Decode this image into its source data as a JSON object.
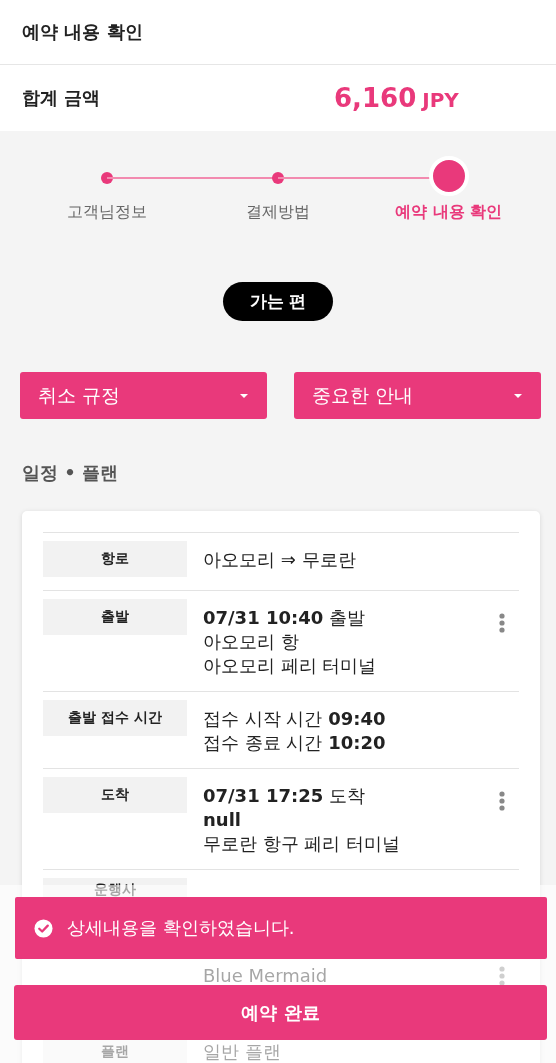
{
  "header": {
    "title": "예약 내용 확인"
  },
  "total": {
    "label": "합계 금액",
    "amount": "6,160",
    "currency": "JPY"
  },
  "steps": [
    {
      "label": "고객님정보",
      "selected": false
    },
    {
      "label": "결제방법",
      "selected": false
    },
    {
      "label": "예약 내용 확인",
      "selected": true
    }
  ],
  "direction_badge": "가는 편",
  "dropdowns": [
    {
      "label": "취소 규정"
    },
    {
      "label": "중요한 안내"
    }
  ],
  "section_title": "일정 • 플랜",
  "rows": [
    {
      "label": "항로",
      "lines": [
        "아오모리 ⇒ 무로란"
      ],
      "has_menu": false
    },
    {
      "label": "출발",
      "lines": [
        "**07/31 10:40** 출발",
        "아오모리 항",
        "아오모리 페리 터미널"
      ],
      "has_menu": true
    },
    {
      "label": "출발 접수 시간",
      "lines": [
        "접수 시작 시간 **09:40**",
        "접수 종료 시간 **10:20**"
      ],
      "has_menu": false
    },
    {
      "label": "도착",
      "lines": [
        "**07/31 17:25** 도착",
        "**null**",
        "무로란 항구 페리 터미널"
      ],
      "has_menu": true
    },
    {
      "label": "운행사",
      "lines": [
        "Blue Mermaid"
      ],
      "has_menu": true
    },
    {
      "label": "플랜",
      "lines": [
        "일반 플랜"
      ],
      "has_menu": false
    }
  ],
  "toast": {
    "message": "상세내용을 확인하였습니다."
  },
  "submit_button": "예약 완료"
}
